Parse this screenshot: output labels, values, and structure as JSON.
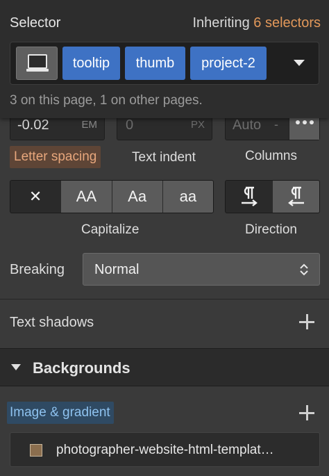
{
  "selector": {
    "title": "Selector",
    "inheriting_prefix": "Inheriting",
    "inheriting_count": "6 selectors",
    "chips": [
      "tooltip",
      "thumb",
      "project-2"
    ],
    "note": "3 on this page, 1 on other pages.",
    "device_icon": "laptop-icon"
  },
  "typography": {
    "letter_spacing": {
      "value": "-0.02",
      "unit": "EM",
      "label": "Letter spacing"
    },
    "text_indent": {
      "value": "0",
      "unit": "PX",
      "label": "Text indent"
    },
    "columns": {
      "value": "Auto",
      "dash": "-",
      "label": "Columns"
    },
    "capitalize": {
      "label": "Capitalize",
      "options": [
        "✕",
        "AA",
        "Aa",
        "aa"
      ],
      "selected": 0
    },
    "direction": {
      "label": "Direction",
      "options": [
        "ltr-icon",
        "rtl-icon"
      ],
      "selected": 0
    },
    "breaking": {
      "label": "Breaking",
      "value": "Normal"
    }
  },
  "text_shadows": {
    "label": "Text shadows"
  },
  "backgrounds": {
    "title": "Backgrounds",
    "image_label": "Image & gradient",
    "file_name": "photographer-website-html-templat…"
  },
  "colors": {
    "accent_orange": "#e2985a",
    "chip_blue": "#3e72c4",
    "link_blue": "#8ec2ef"
  }
}
